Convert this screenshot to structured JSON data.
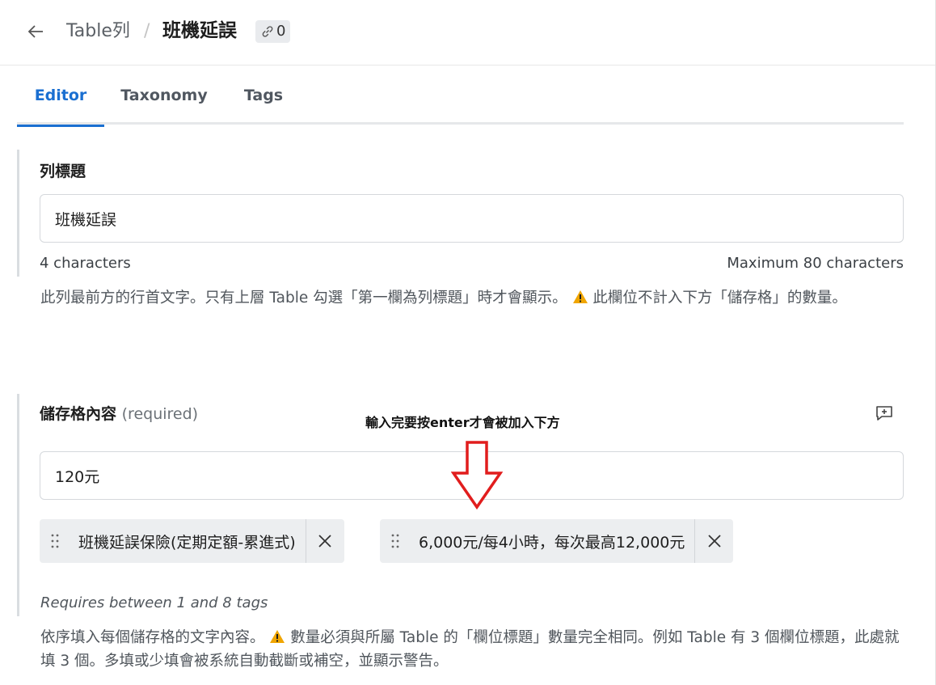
{
  "header": {
    "back_icon": "arrow-left-icon",
    "breadcrumb_parent": "Table列",
    "breadcrumb_separator": "/",
    "title": "班機延誤",
    "link_count": "0"
  },
  "tabs": [
    {
      "label": "Editor",
      "active": true
    },
    {
      "label": "Taxonomy",
      "active": false
    },
    {
      "label": "Tags",
      "active": false
    }
  ],
  "row_title": {
    "label": "列標題",
    "value": "班機延誤",
    "char_count": "4 characters",
    "max_chars": "Maximum 80 characters",
    "help_before": "此列最前方的行首文字。只有上層 Table 勾選「第一欄為列標題」時才會顯示。",
    "help_after": " 此欄位不計入下方「儲存格」的數量。"
  },
  "cells": {
    "label": "儲存格內容",
    "required": "(required)",
    "annotation": "輸入完要按enter才會被加入下方",
    "input_value": "120元",
    "tags": [
      {
        "text": "班機延誤保險(定期定額-累進式)"
      },
      {
        "text": "6,000元/每4小時，每次最高12,000元"
      }
    ],
    "requirement": "Requires between 1 and 8 tags",
    "help_before": "依序填入每個儲存格的文字內容。",
    "help_after": " 數量必須與所屬 Table 的「欄位標題」數量完全相同。例如 Table 有 3 個欄位標題，此處就填 3 個。多填或少填會被系統自動截斷或補空，並顯示警告。"
  },
  "colors": {
    "accent": "#1a6fd1",
    "arrow": "#e11d1d",
    "warning": "#f0a500"
  }
}
